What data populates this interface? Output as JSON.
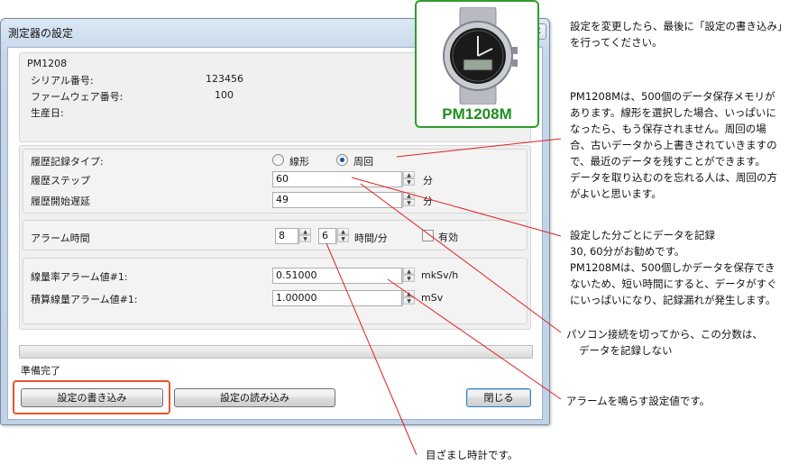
{
  "window": {
    "title": "測定器の設定",
    "close_glyph": "✕"
  },
  "device": {
    "group_title": "PM1208",
    "serial_label": "シリアル番号:",
    "serial_value": "123456",
    "firmware_label": "ファームウェア番号:",
    "firmware_value": "100",
    "production_label": "生産日:",
    "production_value": ""
  },
  "history": {
    "type_label": "履歴記録タイプ:",
    "type_options": [
      "線形",
      "周回"
    ],
    "type_selected": "周回",
    "step_label": "履歴ステップ",
    "step_value": "60",
    "step_unit": "分",
    "delay_label": "履歴開始遅延",
    "delay_value": "49",
    "delay_unit": "分"
  },
  "alarm_time": {
    "label": "アラーム時間",
    "hours": "8",
    "minutes": "6",
    "unit": "時間/分",
    "enabled_label": "有効",
    "enabled": false
  },
  "alarm_values": {
    "dose_rate_label": "線量率アラーム値#1:",
    "dose_rate_value": "0.51000",
    "dose_rate_unit": "mkSv/h",
    "total_dose_label": "積算線量アラーム値#1:",
    "total_dose_value": "1.00000",
    "total_dose_unit": "mSv"
  },
  "status": {
    "text": "準備完了",
    "progress": 0
  },
  "buttons": {
    "write": "設定の書き込み",
    "read": "設定の読み込み",
    "close": "閉じる"
  },
  "product": {
    "name": "PM1208M"
  },
  "annotations": {
    "top_note": [
      "設定を変更したら、最後に「設定の書き込み」",
      "を行ってください。"
    ],
    "history_note": [
      "PM1208Mは、500個のデータ保存メモリが",
      "あります。線形を選択した場合、いっぱいに",
      "なったら、もう保存されません。周回の場",
      "合、古いデータから上書きされていきますの",
      "で、最近のデータを残すことができます。",
      "データを取り込むのを忘れる人は、周回の方",
      "がよいと思います。"
    ],
    "step_note": [
      "設定した分ごとにデータを記録",
      "30, 60分がお勧めです。",
      "PM1208Mは、500個しかデータを保存でき",
      "ないため、短い時間にすると、データがすぐ",
      "にいっぱいになり、記録漏れが発生します。"
    ],
    "delay_note": [
      "パソコン接続を切ってから、この分数は、",
      "データを記録しない"
    ],
    "alarm_value_note": "アラームを鳴らす設定値です。",
    "alarm_clock_note": "目ざまし時計です。"
  },
  "colors": {
    "annotation_line": "#e02020",
    "highlight_box": "#e8552a",
    "product_border": "#2e9d2e"
  }
}
